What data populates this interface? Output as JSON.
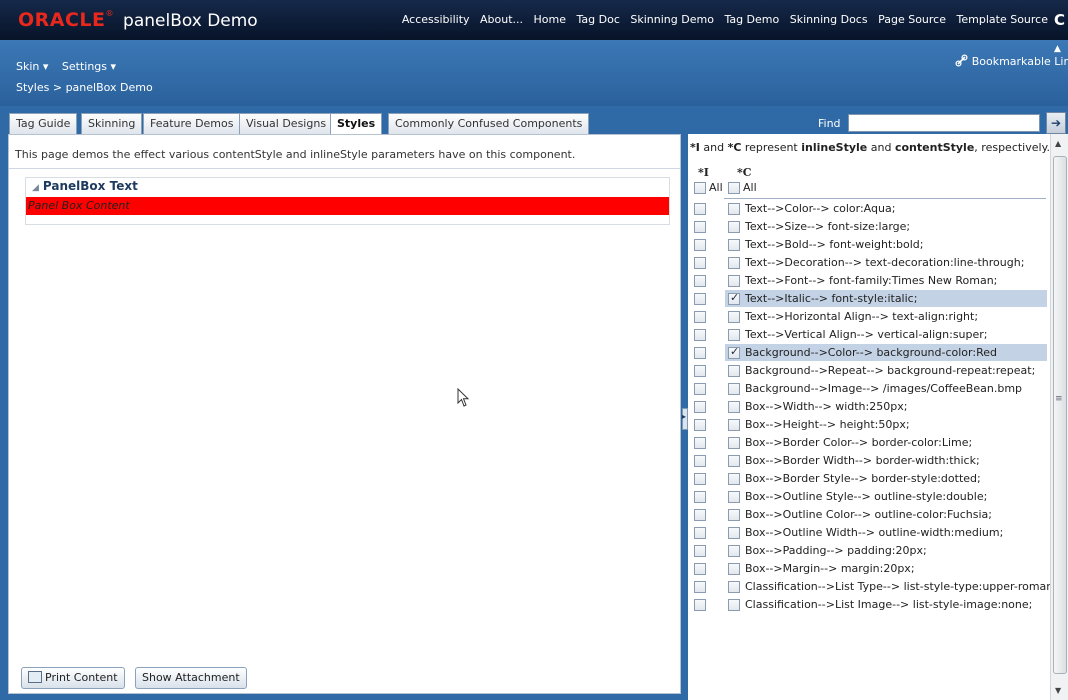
{
  "brand": {
    "oracle": "ORACLE",
    "tm": "®",
    "app_title": "panelBox Demo"
  },
  "top_nav": [
    "Accessibility",
    "About...",
    "Home",
    "Tag Doc",
    "Skinning Demo",
    "Tag Demo",
    "Skinning Docs",
    "Page Source",
    "Template Source"
  ],
  "header": {
    "menus": [
      "Skin ▾",
      "Settings ▾"
    ],
    "breadcrumb": "Styles > panelBox Demo",
    "bookmark": "Bookmarkable Lir"
  },
  "tabs": [
    {
      "label": "Tag Guide"
    },
    {
      "label": "Skinning"
    },
    {
      "label": "Feature Demos"
    },
    {
      "label": "Visual Designs"
    },
    {
      "label": "Styles"
    },
    {
      "label": "Commonly Confused Components"
    }
  ],
  "active_tab": "Styles",
  "find": {
    "label": "Find",
    "value": ""
  },
  "left": {
    "description": "This page demos the effect various contentStyle and inlineStyle parameters have on this component.",
    "panelbox_header": "PanelBox Text",
    "panelbox_content": "Panel Box Content",
    "buttons": {
      "print": "Print Content",
      "attachment": "Show Attachment"
    }
  },
  "right": {
    "legend_i": "*I",
    "legend_mid1": " and ",
    "legend_c": "*C",
    "legend_mid2": " represent ",
    "legend_inline": "inlineStyle",
    "legend_and": " and ",
    "legend_content": "contentStyle",
    "legend_end": ", respectively.",
    "col_i": "*I",
    "col_c": "*C",
    "all_label": "All",
    "options": [
      {
        "label": "Text-->Color--> color:Aqua;",
        "c_checked": false
      },
      {
        "label": "Text-->Size--> font-size:large;",
        "c_checked": false
      },
      {
        "label": "Text-->Bold--> font-weight:bold;",
        "c_checked": false
      },
      {
        "label": "Text-->Decoration--> text-decoration:line-through;",
        "c_checked": false
      },
      {
        "label": "Text-->Font--> font-family:Times New Roman;",
        "c_checked": false
      },
      {
        "label": "Text-->Italic--> font-style:italic;",
        "c_checked": true
      },
      {
        "label": "Text-->Horizontal Align--> text-align:right;",
        "c_checked": false
      },
      {
        "label": "Text-->Vertical Align--> vertical-align:super;",
        "c_checked": false
      },
      {
        "label": "Background-->Color--> background-color:Red",
        "c_checked": true
      },
      {
        "label": "Background-->Repeat--> background-repeat:repeat;",
        "c_checked": false
      },
      {
        "label": "Background-->Image--> /images/CoffeeBean.bmp",
        "c_checked": false
      },
      {
        "label": "Box-->Width--> width:250px;",
        "c_checked": false
      },
      {
        "label": "Box-->Height--> height:50px;",
        "c_checked": false
      },
      {
        "label": "Box-->Border Color--> border-color:Lime;",
        "c_checked": false
      },
      {
        "label": "Box-->Border Width--> border-width:thick;",
        "c_checked": false
      },
      {
        "label": "Box-->Border Style--> border-style:dotted;",
        "c_checked": false
      },
      {
        "label": "Box-->Outline Style--> outline-style:double;",
        "c_checked": false
      },
      {
        "label": "Box-->Outline Color--> outline-color:Fuchsia;",
        "c_checked": false
      },
      {
        "label": "Box-->Outline Width--> outline-width:medium;",
        "c_checked": false
      },
      {
        "label": "Box-->Padding--> padding:20px;",
        "c_checked": false
      },
      {
        "label": "Box-->Margin--> margin:20px;",
        "c_checked": false
      },
      {
        "label": "Classification-->List Type--> list-style-type:upper-roman;",
        "c_checked": false
      },
      {
        "label": "Classification-->List Image--> list-style-image:none;",
        "c_checked": false
      }
    ]
  },
  "colors": {
    "brand_red": "#e8281c",
    "header_blue": "#2f6aa6",
    "topbar": "#0c1f3d",
    "content_bg": "#ff0000",
    "row_highlight": "#c3d2e4"
  },
  "icons": [
    "link-icon",
    "print-icon",
    "disclosure-triangle-icon",
    "find-go-icon",
    "pointer-cursor-icon"
  ]
}
